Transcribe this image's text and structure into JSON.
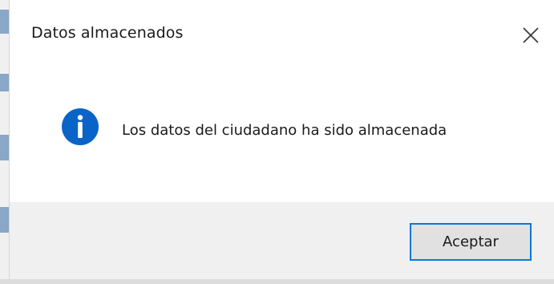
{
  "dialog": {
    "title": "Datos almacenados",
    "message": "Los datos del ciudadano ha sido almacenada",
    "icon": "info-icon",
    "close_icon": "close-icon",
    "ok_label": "Aceptar"
  },
  "colors": {
    "info_icon_bg": "#0a64c8",
    "button_border": "#0b78d7",
    "button_bg": "#e1e1e1",
    "footer_bg": "#f0f0f0"
  }
}
